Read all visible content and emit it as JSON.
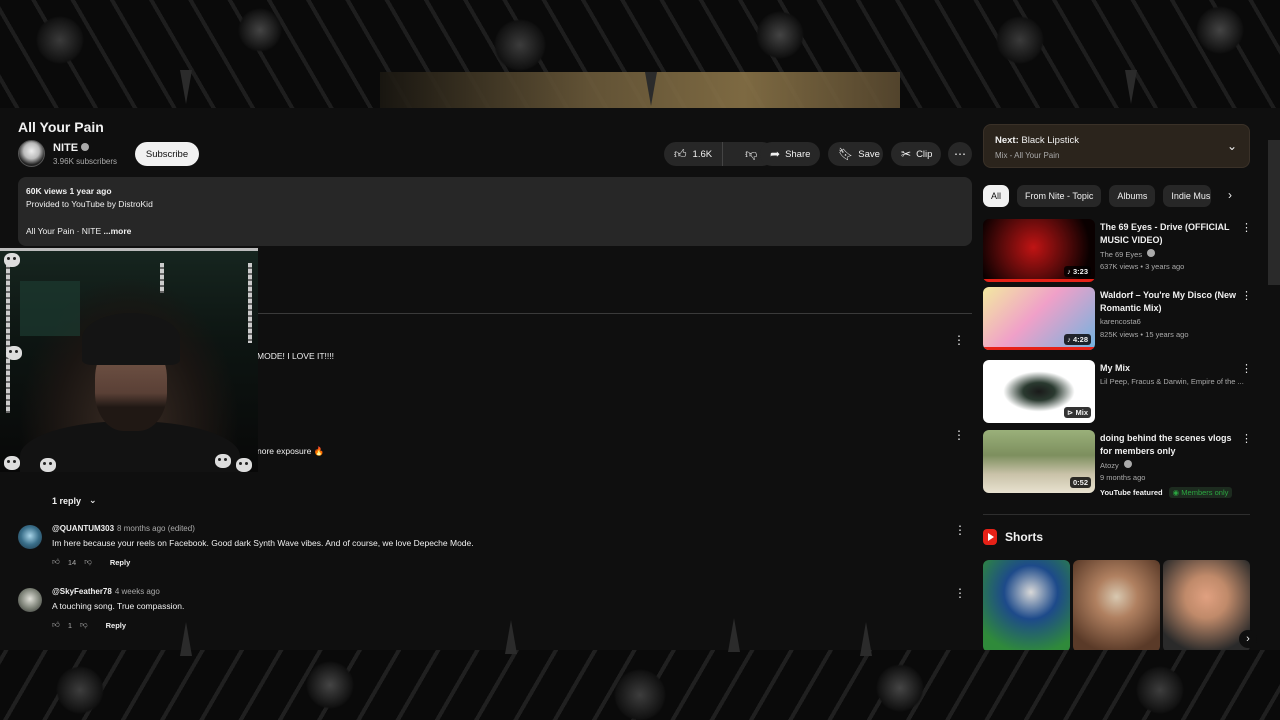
{
  "video": {
    "title": "All Your Pain",
    "channel": "NITE",
    "subscribers": "3.96K subscribers",
    "subscribe_label": "Subscribe",
    "likes": "1.6K",
    "share_label": "Share",
    "save_label": "Save",
    "clip_label": "Clip"
  },
  "description": {
    "stats": "60K views  1 year ago",
    "provided": "Provided to YouTube by DistroKid",
    "snippet": "All Your Pain · NITE ",
    "more": "...more"
  },
  "partial_comments": [
    {
      "text": "MODE!  I LOVE IT!!!!"
    },
    {
      "text": "nore exposure 🔥"
    }
  ],
  "reply_toggle": {
    "label": "1 reply",
    "icon": "chevron-down-icon"
  },
  "comments": [
    {
      "author": "@QUANTUM303",
      "time": "8 months ago (edited)",
      "body": "Im here because your reels on Facebook. Good dark Synth Wave vibes. And of course, we love Depeche Mode.",
      "likes": "14",
      "reply": "Reply",
      "avatar_color": "#3a6f8a"
    },
    {
      "author": "@SkyFeather78",
      "time": "4 weeks ago",
      "body": "A touching song. True compassion.",
      "likes": "1",
      "reply": "Reply",
      "avatar_color": "#7a7f74"
    }
  ],
  "next_up": {
    "prefix": "Next:",
    "title": "Black Lipstick",
    "subtitle": "Mix - All Your Pain"
  },
  "chips": [
    "All",
    "From Nite - Topic",
    "Albums",
    "Indie Music"
  ],
  "recommendations": [
    {
      "title": "The 69 Eyes - Drive (OFFICIAL MUSIC VIDEO)",
      "channel": "The 69 Eyes",
      "meta": "637K views • 3 years ago",
      "duration": "3:23",
      "colors": [
        "#5a0a0a",
        "#c01414"
      ]
    },
    {
      "title": "Waldorf – You're My Disco (New Romantic Mix)",
      "channel": "karencosta6",
      "meta": "825K views • 15 years ago",
      "duration": "4:28",
      "colors": [
        "#f0e070",
        "#e86fa8"
      ]
    },
    {
      "title": "My Mix",
      "channel": "Lil Peep, Fracus & Darwin, Empire of the ...",
      "meta": "",
      "duration": "Mix",
      "colors": [
        "#ffffff",
        "#dddddd"
      ]
    },
    {
      "title": "doing behind the scenes vlogs for members only",
      "channel": "Atozy",
      "meta": "9 months ago",
      "duration": "0:52",
      "featured": "YouTube featured",
      "members": "Members only",
      "colors": [
        "#8fa070",
        "#c9c2a8"
      ]
    }
  ],
  "shorts": {
    "heading": "Shorts",
    "items": [
      {
        "colors": [
          "#1d4a8a",
          "#2f8a3a"
        ]
      },
      {
        "colors": [
          "#5a3a28",
          "#b08060"
        ]
      },
      {
        "colors": [
          "#2a2a2a",
          "#c08a6a"
        ]
      }
    ]
  }
}
